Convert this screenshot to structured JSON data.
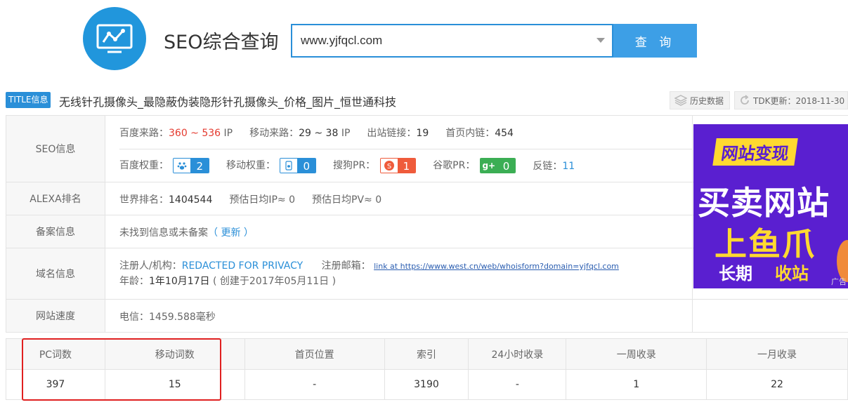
{
  "header": {
    "app_title": "SEO综合查询",
    "search_value": "www.yjfqcl.com",
    "search_button": "查 询"
  },
  "title_line": {
    "tag": "TITLE信息",
    "text": "无线针孔摄像头_最隐蔽伪装隐形针孔摄像头_价格_图片_恒世通科技",
    "history_button": "历史数据",
    "tdk_update": "TDK更新：2018-11-30"
  },
  "seo": {
    "label": "SEO信息",
    "baidu_traffic_label": "百度来路：",
    "baidu_traffic_value": "360 ~ 536",
    "baidu_traffic_unit": "IP",
    "mobile_traffic_label": "移动来路：",
    "mobile_traffic_value": "29 ~ 38",
    "mobile_traffic_unit": "IP",
    "outlinks_label": "出站链接：",
    "outlinks_value": "19",
    "inlinks_label": "首页内链：",
    "inlinks_value": "454",
    "baidu_weight_label": "百度权重：",
    "baidu_weight_value": "2",
    "mobile_weight_label": "移动权重：",
    "mobile_weight_value": "0",
    "sogou_pr_label": "搜狗PR：",
    "sogou_pr_value": "1",
    "google_pr_label": "谷歌PR：",
    "google_pr_value": "0",
    "backlinks_label": "反链：",
    "backlinks_value": "11"
  },
  "alexa": {
    "label": "ALEXA排名",
    "world_rank_label": "世界排名：",
    "world_rank_value": "1404544",
    "daily_ip": "预估日均IP≈ 0",
    "daily_pv": "预估日均PV≈ 0"
  },
  "beian": {
    "label": "备案信息",
    "text": "未找到信息或未备案",
    "update_link": "（ 更新 ）"
  },
  "domain": {
    "label": "域名信息",
    "registrant_label": "注册人/机构：",
    "registrant_value": "REDACTED FOR PRIVACY",
    "email_label": "注册邮箱：",
    "email_link": "link at https://www.west.cn/web/whoisform?domain=yjfqcl.com",
    "age_label": "年龄：",
    "age_value": "1年10月17日",
    "created": "( 创建于2017年05月11日 )"
  },
  "speed": {
    "label": "网站速度",
    "value": "电信：1459.588毫秒"
  },
  "ad": {
    "tag": "网站变现",
    "line1": "买卖网站",
    "line2": "上鱼爪",
    "line3a": "长期",
    "line3b": "收站",
    "ad_label": "广告"
  },
  "stats": {
    "headers": [
      "PC词数",
      "移动词数",
      "首页位置",
      "索引",
      "24小时收录",
      "一周收录",
      "一月收录"
    ],
    "values": [
      "397",
      "15",
      "-",
      "3190",
      "-",
      "1",
      "22"
    ]
  },
  "colors": {
    "accent": "#2a8fd8",
    "traffic_red": "#e43a2f",
    "highlight_border": "#e02020",
    "ad_bg": "#5a1fd0",
    "ad_yellow": "#ffd930"
  }
}
